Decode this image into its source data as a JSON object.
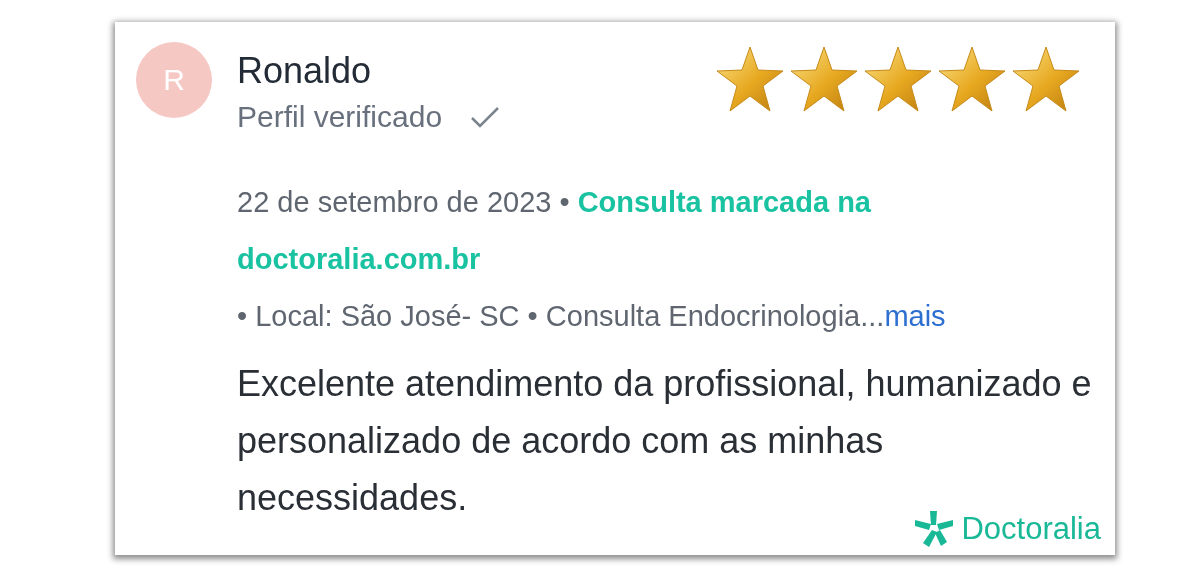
{
  "review": {
    "avatar_initial": "R",
    "author": "Ronaldo",
    "verified_label": "Perfil verificado",
    "verified": true,
    "stars": 5,
    "meta": "22 de setembro de 2023 • **Consulta marcada na doctoralia.com.br**",
    "details": "• Local: São José- SC • Consulta Endocrinologia...",
    "more_link": "mais",
    "text": "Excelente atendimento da profissional, humanizado e personalizado de acordo com as minhas necessidades."
  },
  "brand": {
    "name": "Doctoralia"
  }
}
